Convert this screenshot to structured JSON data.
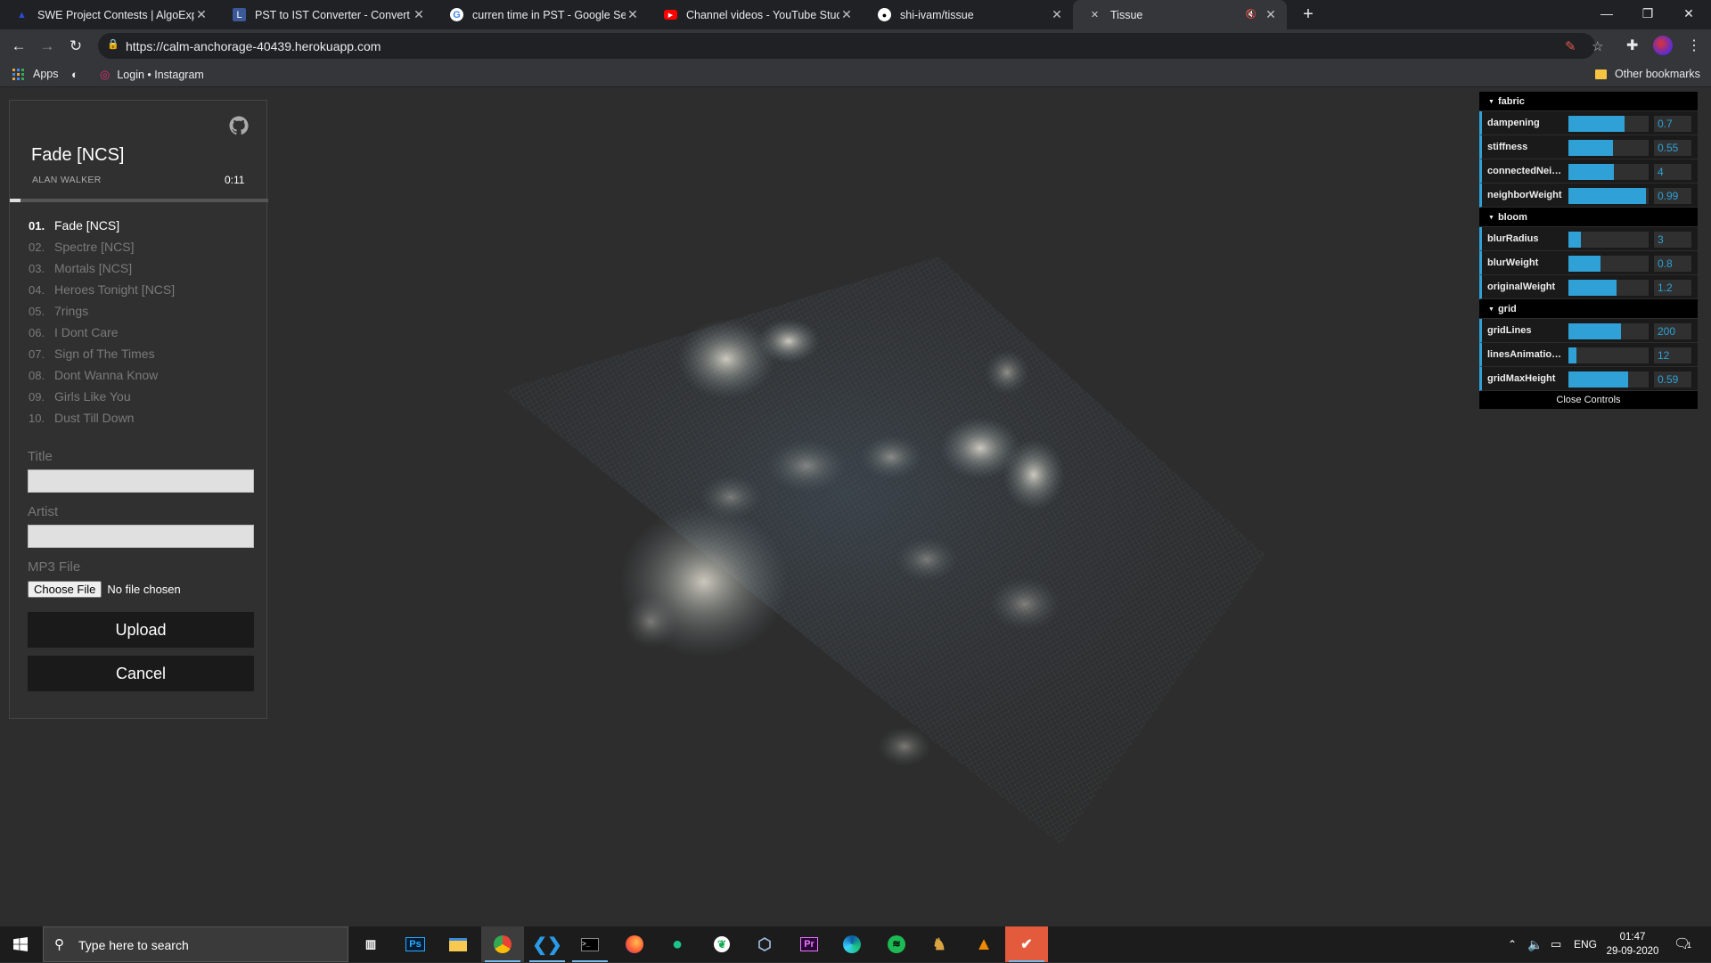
{
  "browser": {
    "tabs": [
      {
        "label": "SWE Project Contests | AlgoExpe",
        "icon": "algoexpert-icon",
        "active": false
      },
      {
        "label": "PST to IST Converter - Convert P",
        "icon": "converter-icon",
        "active": false
      },
      {
        "label": "curren time in PST - Google Sear",
        "icon": "google-icon",
        "active": false
      },
      {
        "label": "Channel videos - YouTube Studio",
        "icon": "youtube-icon",
        "active": false
      },
      {
        "label": "shi-ivam/tissue",
        "icon": "github-icon",
        "active": false
      },
      {
        "label": "Tissue",
        "icon": "tissue-icon",
        "active": true
      }
    ],
    "url": "https://calm-anchorage-40439.herokuapp.com",
    "bookmarks": {
      "apps": "Apps",
      "instagram": "Login • Instagram",
      "other": "Other bookmarks"
    }
  },
  "player": {
    "title": "Fade [NCS]",
    "artist": "ALAN WALKER",
    "time": "0:11",
    "progress": 0.04,
    "playlist": [
      {
        "num": "01.",
        "name": "Fade [NCS]",
        "active": true
      },
      {
        "num": "02.",
        "name": "Spectre [NCS]",
        "active": false
      },
      {
        "num": "03.",
        "name": "Mortals [NCS]",
        "active": false
      },
      {
        "num": "04.",
        "name": "Heroes Tonight [NCS]",
        "active": false
      },
      {
        "num": "05.",
        "name": "7rings",
        "active": false
      },
      {
        "num": "06.",
        "name": "I Dont Care",
        "active": false
      },
      {
        "num": "07.",
        "name": "Sign of The Times",
        "active": false
      },
      {
        "num": "08.",
        "name": "Dont Wanna Know",
        "active": false
      },
      {
        "num": "09.",
        "name": "Girls Like You",
        "active": false
      },
      {
        "num": "10.",
        "name": "Dust Till Down",
        "active": false
      }
    ],
    "form": {
      "title_label": "Title",
      "title_value": "",
      "artist_label": "Artist",
      "artist_value": "",
      "file_label": "MP3 File",
      "choose_file": "Choose File",
      "no_file": "No file chosen",
      "upload": "Upload",
      "cancel": "Cancel"
    }
  },
  "controls": {
    "folders": [
      {
        "name": "fabric",
        "items": [
          {
            "name": "dampening",
            "value": "0.7",
            "fill": 0.7
          },
          {
            "name": "stiffness",
            "value": "0.55",
            "fill": 0.55
          },
          {
            "name": "connectedNeigh...",
            "value": "4",
            "fill": 0.57
          },
          {
            "name": "neighborWeight",
            "value": "0.99",
            "fill": 0.97
          }
        ]
      },
      {
        "name": "bloom",
        "items": [
          {
            "name": "blurRadius",
            "value": "3",
            "fill": 0.15
          },
          {
            "name": "blurWeight",
            "value": "0.8",
            "fill": 0.4
          },
          {
            "name": "originalWeight",
            "value": "1.2",
            "fill": 0.6
          }
        ]
      },
      {
        "name": "grid",
        "items": [
          {
            "name": "gridLines",
            "value": "200",
            "fill": 0.66
          },
          {
            "name": "linesAnimationO...",
            "value": "12",
            "fill": 0.1
          },
          {
            "name": "gridMaxHeight",
            "value": "0.59",
            "fill": 0.74
          }
        ]
      }
    ],
    "close": "Close Controls",
    "accent": "#2fa1d6"
  },
  "taskbar": {
    "search_placeholder": "Type here to search",
    "language": "ENG",
    "time": "01:47",
    "date": "29-09-2020",
    "notifications": "1",
    "apps": [
      "task-view-icon",
      "photoshop-icon",
      "file-explorer-icon",
      "chrome-icon",
      "vscode-icon",
      "terminal-icon",
      "firefox-icon",
      "gitkraken-icon",
      "mongodb-icon",
      "virtualbox-icon",
      "premiere-icon",
      "edge-icon",
      "spotify-icon",
      "game-icon",
      "vlc-icon",
      "app-icon"
    ]
  }
}
